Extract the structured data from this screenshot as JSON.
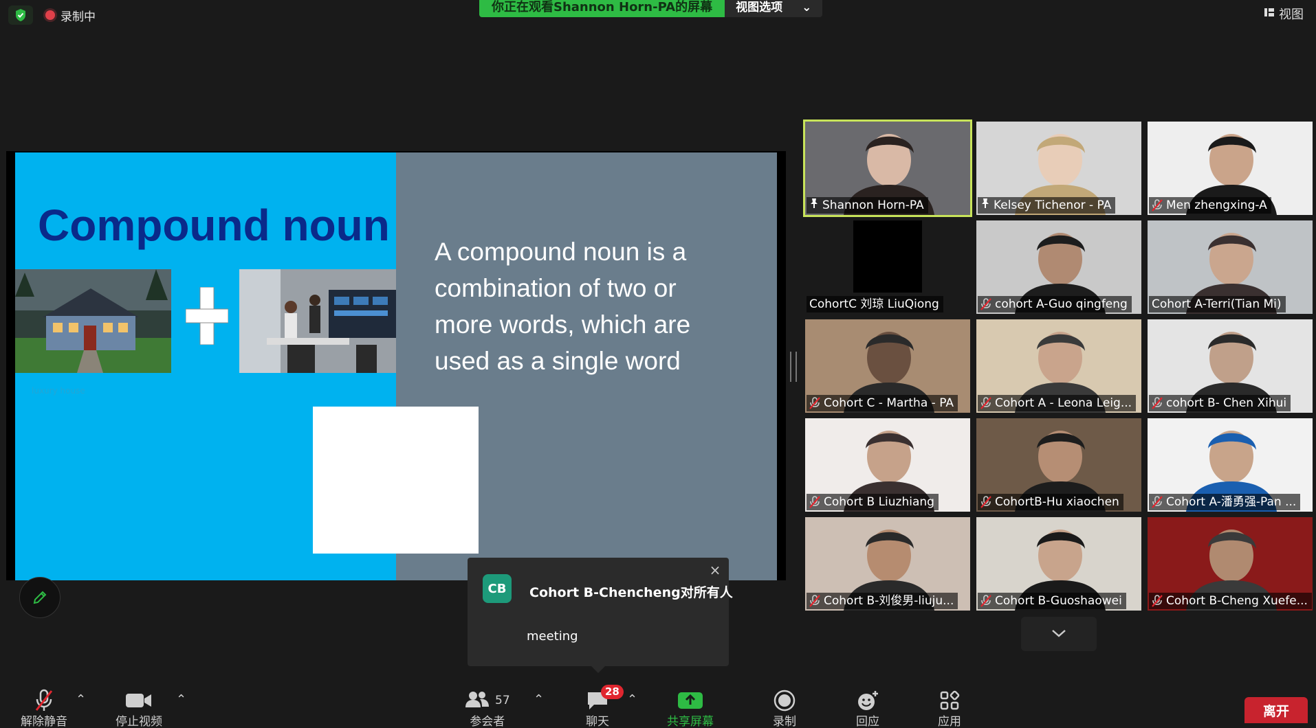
{
  "top_bar": {
    "recording_label": "录制中",
    "viewing_banner": "你正在观看Shannon  Horn-PA的屏幕",
    "view_options_label": "视图选项",
    "view_label": "视图"
  },
  "slide": {
    "title": "Compound noun",
    "body": "A compound noun is a combination of two or more words, which are used as a single word",
    "image_caption": "luxury house",
    "plus_symbol": "+"
  },
  "participants": [
    {
      "name": "Shannon Horn-PA",
      "icon": "pin-icon",
      "active": true
    },
    {
      "name": "Kelsey Tichenor - PA",
      "icon": "pin-icon"
    },
    {
      "name": "Men zhengxing-A",
      "icon": "mic-muted-icon"
    },
    {
      "name": "CohortC 刘琼 LiuQiong",
      "icon": ""
    },
    {
      "name": "cohort A-Guo qingfeng",
      "icon": "mic-muted-icon"
    },
    {
      "name": "Cohort A-Terri(Tian Mi)",
      "icon": ""
    },
    {
      "name": "Cohort C - Martha - PA",
      "icon": "mic-muted-icon"
    },
    {
      "name": "Cohort A - Leona Leig...",
      "icon": "mic-muted-icon"
    },
    {
      "name": "cohort B- Chen Xihui",
      "icon": "mic-muted-icon"
    },
    {
      "name": "Cohort B Liuzhiang",
      "icon": "mic-muted-icon"
    },
    {
      "name": "CohortB-Hu xiaochen",
      "icon": "mic-muted-icon"
    },
    {
      "name": "Cohort A-潘勇强-Pan ...",
      "icon": "mic-muted-icon"
    },
    {
      "name": "Cohort B-刘俊男-liuju...",
      "icon": "mic-muted-icon"
    },
    {
      "name": "Cohort B-Guoshaowei",
      "icon": "mic-muted-icon"
    },
    {
      "name": "Cohort B-Cheng Xuefe...",
      "icon": "mic-muted-icon"
    }
  ],
  "chat_popup": {
    "avatar_initials": "CB",
    "sender": "Cohort B-Chencheng对所有人",
    "message": "meeting",
    "close_symbol": "×"
  },
  "toolbar": {
    "unmute_label": "解除静音",
    "stop_video_label": "停止视频",
    "participants_label": "参会者",
    "participants_count": "57",
    "chat_label": "聊天",
    "chat_badge": "28",
    "share_label": "共享屏幕",
    "record_label": "录制",
    "reactions_label": "回应",
    "apps_label": "应用",
    "leave_label": "离开"
  },
  "colors": {
    "slide_left": "#00b2ef",
    "slide_right": "#6a7d8c",
    "title": "#0a2a8a",
    "active_speaker": "#c8e45a",
    "recording": "#e0404a",
    "banner": "#2ebb44",
    "share": "#2ebb44",
    "leave": "#c8232e"
  }
}
